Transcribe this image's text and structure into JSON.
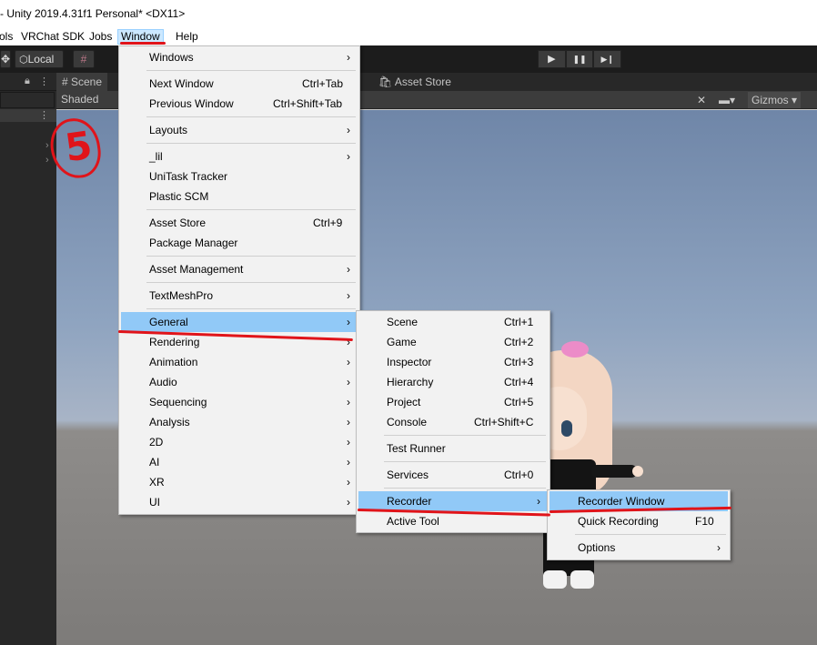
{
  "window": {
    "title": "- Unity 2019.4.31f1 Personal* <DX11>"
  },
  "menubar": {
    "items": [
      {
        "label": "ols"
      },
      {
        "label": "VRChat SDK"
      },
      {
        "label": "Jobs"
      },
      {
        "label": "Window",
        "active": true
      },
      {
        "label": "Help"
      }
    ]
  },
  "toolbar": {
    "pivot_mode": "Local",
    "play_icon": "▶",
    "pause_icon": "❚❚",
    "step_icon": "▶❙"
  },
  "scene": {
    "tab_scene": "# Scene",
    "tab_asset_store": "Asset Store",
    "shading_mode": "Shaded",
    "gizmos_label": "Gizmos"
  },
  "annotation": {
    "step_number": "5"
  },
  "window_menu": {
    "items": [
      {
        "label": "Windows",
        "submenu": true
      },
      {
        "label": "Next Window",
        "shortcut": "Ctrl+Tab"
      },
      {
        "label": "Previous Window",
        "shortcut": "Ctrl+Shift+Tab"
      },
      {
        "label": "Layouts",
        "submenu": true
      },
      {
        "label": "_lil",
        "submenu": true
      },
      {
        "label": "UniTask Tracker"
      },
      {
        "label": "Plastic SCM"
      },
      {
        "label": "Asset Store",
        "shortcut": "Ctrl+9"
      },
      {
        "label": "Package Manager"
      },
      {
        "label": "Asset Management",
        "submenu": true
      },
      {
        "label": "TextMeshPro",
        "submenu": true
      },
      {
        "label": "General",
        "submenu": true,
        "highlighted": true
      },
      {
        "label": "Rendering",
        "submenu": true
      },
      {
        "label": "Animation",
        "submenu": true
      },
      {
        "label": "Audio",
        "submenu": true
      },
      {
        "label": "Sequencing",
        "submenu": true
      },
      {
        "label": "Analysis",
        "submenu": true
      },
      {
        "label": "2D",
        "submenu": true
      },
      {
        "label": "AI",
        "submenu": true
      },
      {
        "label": "XR",
        "submenu": true
      },
      {
        "label": "UI",
        "submenu": true
      }
    ]
  },
  "general_menu": {
    "items": [
      {
        "label": "Scene",
        "shortcut": "Ctrl+1"
      },
      {
        "label": "Game",
        "shortcut": "Ctrl+2"
      },
      {
        "label": "Inspector",
        "shortcut": "Ctrl+3"
      },
      {
        "label": "Hierarchy",
        "shortcut": "Ctrl+4"
      },
      {
        "label": "Project",
        "shortcut": "Ctrl+5"
      },
      {
        "label": "Console",
        "shortcut": "Ctrl+Shift+C"
      },
      {
        "label": "Test Runner"
      },
      {
        "label": "Services",
        "shortcut": "Ctrl+0"
      },
      {
        "label": "Recorder",
        "submenu": true,
        "highlighted": true
      },
      {
        "label": "Active Tool"
      }
    ]
  },
  "recorder_menu": {
    "items": [
      {
        "label": "Recorder Window",
        "highlighted": true
      },
      {
        "label": "Quick Recording",
        "shortcut": "F10"
      },
      {
        "label": "Options",
        "submenu": true
      }
    ]
  },
  "colors": {
    "menu_highlight": "#91c9f7",
    "annotation_red": "#e0141a",
    "menubar_active": "#cce8ff"
  }
}
